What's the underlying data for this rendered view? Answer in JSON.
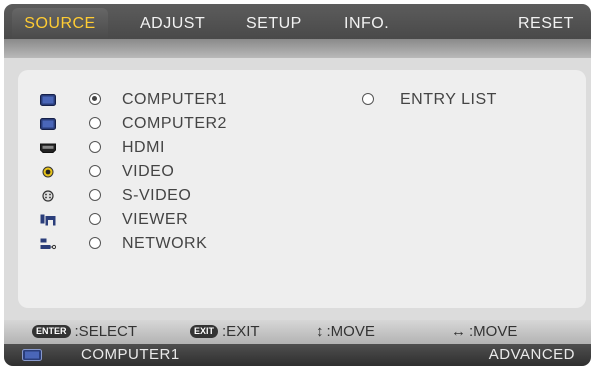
{
  "tabs": [
    {
      "label": "SOURCE",
      "active": true
    },
    {
      "label": "ADJUST",
      "active": false
    },
    {
      "label": "SETUP",
      "active": false
    },
    {
      "label": "INFO.",
      "active": false
    },
    {
      "label": "RESET",
      "active": false
    }
  ],
  "sources": [
    {
      "label": "COMPUTER1",
      "icon": "monitor-icon",
      "selected": true
    },
    {
      "label": "COMPUTER2",
      "icon": "monitor-icon",
      "selected": false
    },
    {
      "label": "HDMI",
      "icon": "hdmi-icon",
      "selected": false
    },
    {
      "label": "VIDEO",
      "icon": "rca-video-icon",
      "selected": false
    },
    {
      "label": "S-VIDEO",
      "icon": "svideo-icon",
      "selected": false
    },
    {
      "label": "VIEWER",
      "icon": "viewer-icon",
      "selected": false
    },
    {
      "label": "NETWORK",
      "icon": "network-icon",
      "selected": false
    }
  ],
  "entry_list": {
    "label": "ENTRY LIST",
    "selected": false
  },
  "help": {
    "enter_key": "ENTER",
    "select_label": ":SELECT",
    "exit_key": "EXIT",
    "exit_label": ":EXIT",
    "updown_glyph": "↕",
    "move_label_1": ":MOVE",
    "leftright_glyph": "↔",
    "move_label_2": ":MOVE"
  },
  "status": {
    "source": "COMPUTER1",
    "mode": "ADVANCED",
    "icon": "monitor-icon"
  },
  "colors": {
    "active_tab_text": "#ffcc33",
    "tab_text": "#f2f2f2",
    "icon_blue": "#2a3d7a"
  }
}
